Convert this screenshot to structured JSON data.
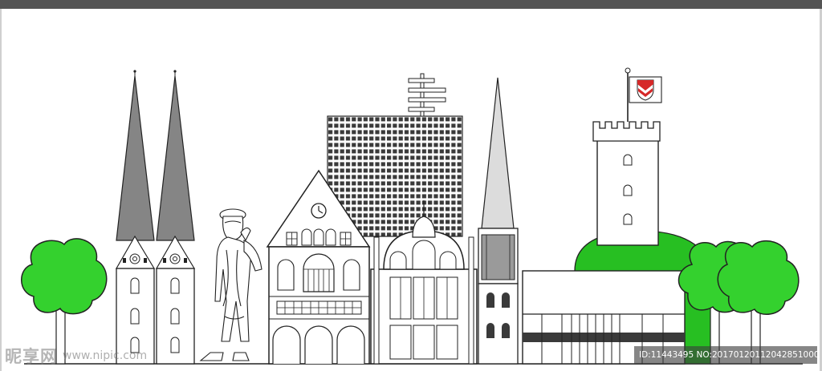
{
  "watermark": {
    "logo_text": "昵享网",
    "url_text": "www.nipic.com",
    "id_text": "ID:11443495 NO:20170120112042851000"
  },
  "colors": {
    "spire_grey": "#858585",
    "tree_green": "#34d12e",
    "hill_green": "#27bf22",
    "flag_red": "#d62828",
    "outline": "#222222"
  },
  "icons": [
    "clock-icon",
    "coat-of-arms-icon"
  ]
}
